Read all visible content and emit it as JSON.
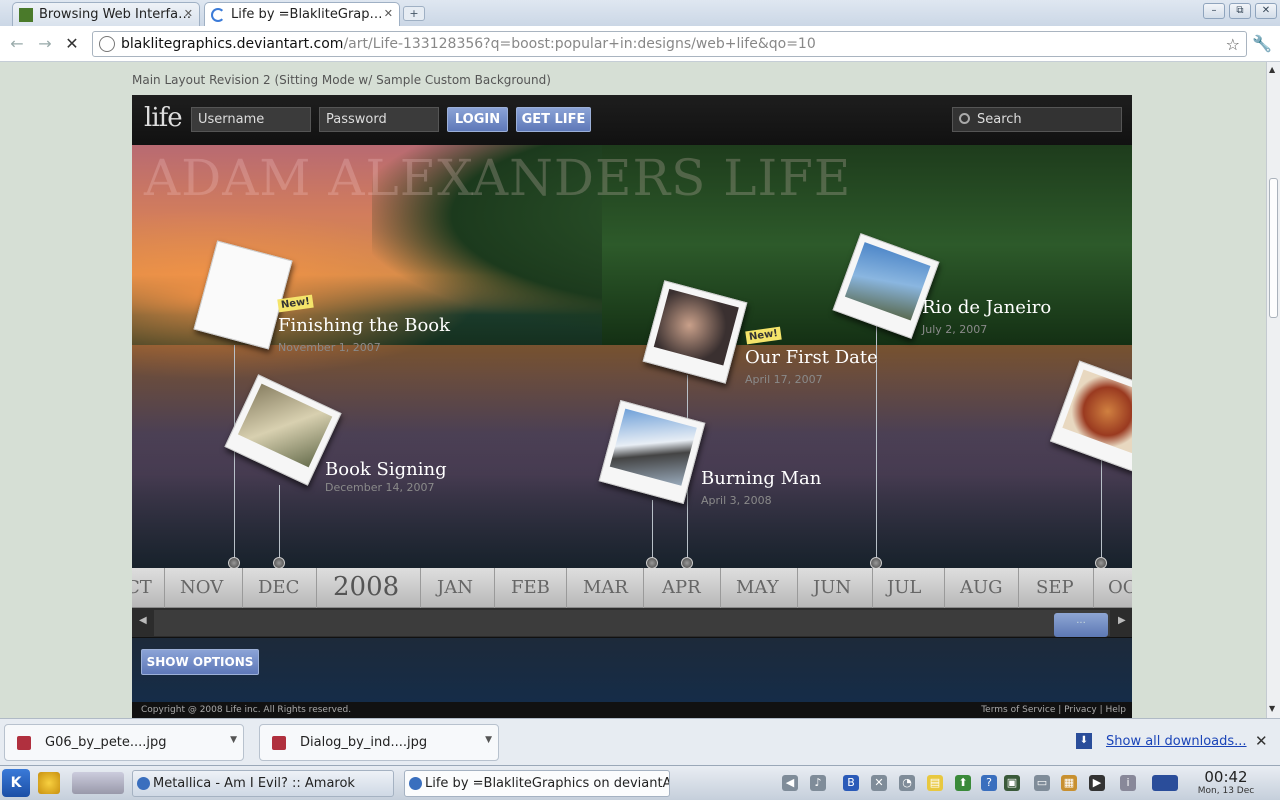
{
  "tabs": [
    {
      "label": "Browsing Web Interfa…",
      "active": false
    },
    {
      "label": "Life by =BlakliteGrap…",
      "active": true
    }
  ],
  "window_controls": {
    "minimize": "–",
    "restore": "⧉",
    "close": "✕"
  },
  "toolbar": {
    "url_domain": "blaklitegraphics.deviantart.com",
    "url_path": "/art/Life-133128356?q=boost:popular+in:designs/web+life&qo=10",
    "back_icon": "←",
    "forward_icon": "→",
    "stop_icon": "✕",
    "star_icon": "☆",
    "wrench_icon": "🔧"
  },
  "page": {
    "caption": "Main Layout Revision 2 (Sitting Mode w/ Sample Custom Background)",
    "logo": "life",
    "username_placeholder": "Username",
    "password_placeholder": "Password",
    "login_label": "LOGIN",
    "getlife_label": "GET LIFE",
    "search_placeholder": "Search",
    "big_title": "ADAM ALEXANDERS LIFE",
    "events": [
      {
        "title": "Finishing the Book",
        "date": "November 1, 2007",
        "new": true,
        "new_label": "New!"
      },
      {
        "title": "Book Signing",
        "date": "December 14, 2007",
        "new": false
      },
      {
        "title": "Our First Date",
        "date": "April 17, 2007",
        "new": true,
        "new_label": "New!"
      },
      {
        "title": "Burning Man",
        "date": "April 3, 2008",
        "new": false
      },
      {
        "title": "Rio de Janeiro",
        "date": "July 2, 2007",
        "new": false
      }
    ],
    "months": [
      "CT",
      "NOV",
      "DEC",
      "2008",
      "JAN",
      "FEB",
      "MAR",
      "APR",
      "MAY",
      "JUN",
      "JUL",
      "AUG",
      "SEP",
      "OC"
    ],
    "slider_knob": "···",
    "show_options": "SHOW OPTIONS",
    "copyright": "Copyright @ 2008 Life inc. All Rights reserved.",
    "footer_links": "Terms of Service | Privacy | Help"
  },
  "downloads": {
    "items": [
      {
        "name": "G06_by_pete....jpg"
      },
      {
        "name": "Dialog_by_ind....jpg"
      }
    ],
    "show_all": "Show all downloads..."
  },
  "taskbar": {
    "tasks": [
      {
        "label": "Metallica - Am I Evil?  ::  Amarok"
      },
      {
        "label": "Life by =BlakliteGraphics on deviantART"
      }
    ],
    "time": "00:42",
    "date": "Mon, 13 Dec"
  }
}
